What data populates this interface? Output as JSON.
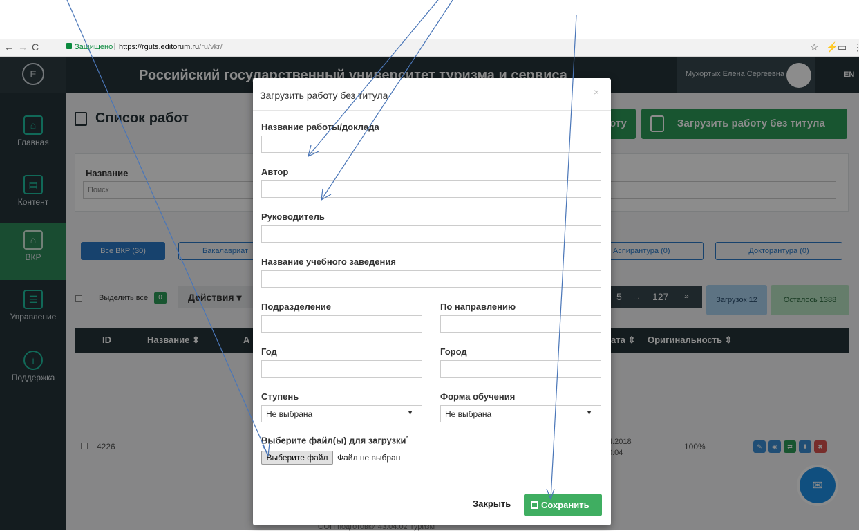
{
  "browser": {
    "secure_label": "Защищено",
    "url_host": "https://rguts.editorum.ru",
    "url_path": "/ru/vkr/"
  },
  "sidebar": {
    "logo_letter": "E",
    "items": [
      {
        "label": "Главная",
        "icon": "home-icon"
      },
      {
        "label": "Контент",
        "icon": "newspaper-icon"
      },
      {
        "label": "ВКР",
        "icon": "university-icon"
      },
      {
        "label": "Управление",
        "icon": "sliders-icon"
      },
      {
        "label": "Поддержка",
        "icon": "info-icon"
      }
    ]
  },
  "header": {
    "title": "Российский государственный университет туризма и сервиса",
    "user_name": "Мухортых Елена Сергеевна",
    "lang": "EN"
  },
  "main": {
    "page_title": "Список работ",
    "btn_upload_title_partial": "оту",
    "btn_upload_no_title": "Загрузить работу без титула",
    "filter_name_label": "Название",
    "filter_search_placeholder": "Поиск",
    "tabs": {
      "all": "Все ВКР (30)",
      "bachelor": "Бакалавриат",
      "aspirant": "Аспирантура (0)",
      "doctorant": "Докторантура (0)"
    },
    "select_all_label": "Выделить все",
    "select_count": "0",
    "actions_label": "Действия ▾",
    "pager": [
      "5",
      "...",
      "127",
      "»"
    ],
    "loaded_label": "Загрузок 12",
    "left_label": "Осталось 1388",
    "table_headers": {
      "id": "ID",
      "name": "Название ⇕",
      "a": "А",
      "date": "ата ⇕",
      "orig": "Оригинальность ⇕"
    },
    "row": {
      "id": "4226",
      "date_line1": "4.2018",
      "date_line2": "0:04",
      "originality": "100%"
    },
    "bottom_cut_text": "ООП подготовки 43.04.02 Туризм"
  },
  "modal": {
    "title": "Загрузить работу без титула",
    "close_x": "×",
    "fields": {
      "work_title_label": "Название работы/доклада",
      "author_label": "Автор",
      "supervisor_label": "Руководитель",
      "institution_label": "Название учебного заведения",
      "department_label": "Подразделение",
      "direction_label": "По направлению",
      "year_label": "Год",
      "city_label": "Город",
      "level_label": "Ступень",
      "level_value": "Не выбрана",
      "form_label": "Форма обучения",
      "form_value": "Не выбрана",
      "file_label": "Выберите файл(ы) для загрузки",
      "file_required_mark": "*",
      "file_button": "Выберите файл",
      "file_status": "Файл не выбран"
    },
    "close_button": "Закрыть",
    "save_button": "Сохранить"
  },
  "colors": {
    "sidebar_bg": "#26333a",
    "accent_green": "#2c9b58",
    "save_green": "#3fae61",
    "tab_blue": "#2a79c7",
    "annotation_arrow": "#4a76b8"
  }
}
